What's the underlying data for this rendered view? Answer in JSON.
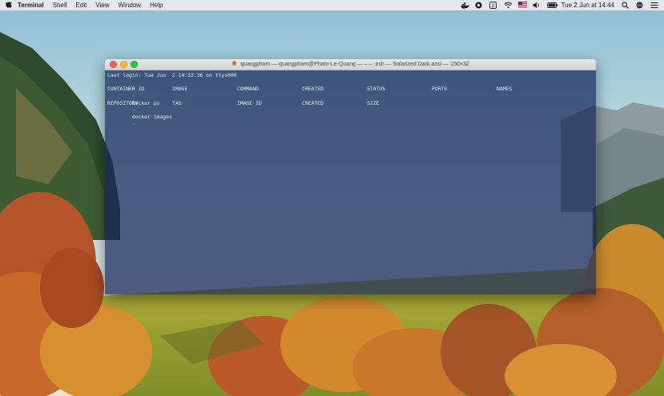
{
  "menubar": {
    "apple_glyph": "",
    "items": [
      "Terminal",
      "Shell",
      "Edit",
      "View",
      "Window",
      "Help"
    ],
    "status": {
      "datetime": "Tue 2 Jun at 14:44",
      "icons": [
        "docker-icon",
        "record-icon",
        "number-2-icon",
        "wifi-icon",
        "us-flag-icon",
        "volume-icon",
        "battery-icon",
        "search-icon",
        "siri-icon",
        "list-icon"
      ]
    }
  },
  "terminal": {
    "title": "quangpham — quangpham@Pham-Le-Quang — ‒ ‒ -zsh — Solarized Dark ansi — 150×32",
    "last_login": "Last login: Tue Jun  2 14:32:36 on ttys000",
    "prompt_arrow": "➜",
    "prompt_tilde": "~",
    "commands": [
      "docker ps",
      "docker images"
    ],
    "ps_headers": [
      "CONTAINER ID",
      "IMAGE",
      "COMMAND",
      "CREATED",
      "STATUS",
      "PORTS",
      "NAMES"
    ],
    "images_headers": [
      "REPOSITORY",
      "TAG",
      "IMAGE ID",
      "CREATED",
      "SIZE"
    ],
    "colors": {
      "background": "#16285a",
      "text": "#e6ecf2",
      "prompt_arrow": "#4fd1a8",
      "prompt_tilde": "#58b6e8"
    }
  }
}
